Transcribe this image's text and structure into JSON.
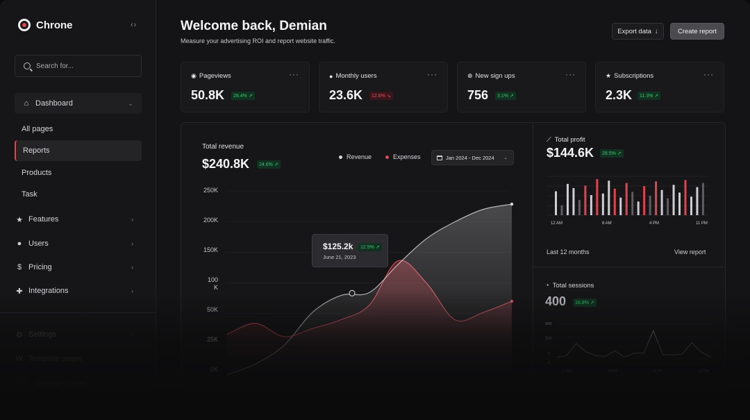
{
  "app": {
    "name": "Chrone",
    "collapse_glyph": "‹›"
  },
  "search": {
    "placeholder": "Search for..."
  },
  "sidebar": {
    "dashboard": "Dashboard",
    "subitems": [
      "All pages",
      "Reports",
      "Products",
      "Task"
    ],
    "active": "Reports",
    "items": [
      {
        "label": "Features",
        "icon": "star-icon"
      },
      {
        "label": "Users",
        "icon": "user-icon"
      },
      {
        "label": "Pricing",
        "icon": "dollar-icon"
      },
      {
        "label": "Integrations",
        "icon": "puzzle-icon"
      }
    ],
    "bottom": [
      {
        "label": "Settings",
        "icon": "gear-icon"
      },
      {
        "label": "Template pages",
        "icon": "w-icon"
      },
      {
        "label": "Damian Carter",
        "icon": "avatar"
      }
    ]
  },
  "header": {
    "title": "Welcome back, Demian",
    "subtitle": "Measure your advertising ROI and report website traffic.",
    "export_label": "Export data",
    "create_label": "Create report"
  },
  "stats": [
    {
      "label": "Pageviews",
      "icon": "eye-icon",
      "value": "50.8K",
      "change": "28.4% ↗",
      "trend": "up"
    },
    {
      "label": "Monthly users",
      "icon": "user-icon",
      "value": "23.6K",
      "change": "12.6% ↘",
      "trend": "down"
    },
    {
      "label": "New sign ups",
      "icon": "plus-circle-icon",
      "value": "756",
      "change": "3.1% ↗",
      "trend": "up"
    },
    {
      "label": "Subscriptions",
      "icon": "star-icon",
      "value": "2.3K",
      "change": "11.3% ↗",
      "trend": "up"
    }
  ],
  "revenue": {
    "label": "Total revenue",
    "value": "$240.8K",
    "change": "24.6% ↗",
    "legend": {
      "revenue": "Revenue",
      "expenses": "Expenses"
    },
    "date_range": "Jan 2024 - Dec 2024",
    "y_ticks": [
      "250K",
      "200K",
      "150K",
      "100\nK",
      "50K",
      "25K",
      "0K"
    ],
    "tooltip": {
      "value": "$125.2k",
      "change": "12.5% ↗",
      "date": "June 21, 2023"
    }
  },
  "profit": {
    "label": "Total profit",
    "value": "$144.6K",
    "change": "28.5% ↗",
    "x_ticks": [
      "12 AM",
      "8 AM",
      "4 PM",
      "11 PM"
    ],
    "footer_left": "Last 12 months",
    "footer_right": "View report"
  },
  "sessions": {
    "label": "Total sessions",
    "value": "400",
    "change": "16.8% ↗",
    "y_ticks": [
      "500",
      "250",
      "5",
      "0"
    ],
    "x_ticks": [
      "12 AM",
      "8 AM",
      "4 PM",
      "11 PM"
    ]
  },
  "colors": {
    "accent": "#e0454f",
    "revenue_line": "#d9d9dd",
    "expenses_line": "#d9535c",
    "up": "#3bc46f",
    "down": "#e05763"
  },
  "chart_data": [
    {
      "type": "area",
      "title": "Total revenue",
      "xlabel": "",
      "ylabel": "",
      "ylim": [
        0,
        250
      ],
      "y_ticks": [
        "250K",
        "200K",
        "150K",
        "100K",
        "50K",
        "25K",
        "0K"
      ],
      "x": [
        0,
        1,
        2,
        3,
        4,
        5,
        6,
        7,
        8,
        9,
        10
      ],
      "series": [
        {
          "name": "Revenue",
          "values": [
            0,
            15,
            40,
            85,
            108,
            112,
            150,
            185,
            208,
            225,
            232
          ]
        },
        {
          "name": "Expenses",
          "values": [
            55,
            70,
            52,
            63,
            75,
            95,
            155,
            125,
            75,
            85,
            100
          ]
        }
      ],
      "legend": "top-right"
    },
    {
      "type": "bar",
      "title": "Total profit",
      "categories": [
        "12 AM",
        "8 AM",
        "4 PM",
        "11 PM"
      ],
      "values": [
        0.62,
        0.18,
        0.85,
        0.72,
        0.35,
        0.8,
        0.5,
        1.0,
        0.55,
        0.95,
        0.7,
        0.42,
        0.88,
        0.6,
        0.3,
        0.78,
        0.48,
        0.93,
        0.66,
        0.4,
        0.82,
        0.58,
        0.97,
        0.45,
        0.75,
        0.88
      ],
      "highlighted": [
        0,
        0,
        0,
        0,
        0,
        1,
        0,
        1,
        0,
        0,
        1,
        0,
        1,
        0,
        0,
        1,
        0,
        1,
        0,
        0,
        0,
        0,
        1,
        0,
        0,
        0
      ],
      "grid": true
    },
    {
      "type": "line",
      "title": "Total sessions",
      "categories": [
        "12 AM",
        "8 AM",
        "4 PM",
        "11 PM"
      ],
      "values": [
        90,
        110,
        260,
        160,
        110,
        100,
        170,
        90,
        140,
        140,
        420,
        120,
        120,
        130,
        270,
        150,
        90
      ],
      "ylim": [
        0,
        500
      ]
    }
  ]
}
